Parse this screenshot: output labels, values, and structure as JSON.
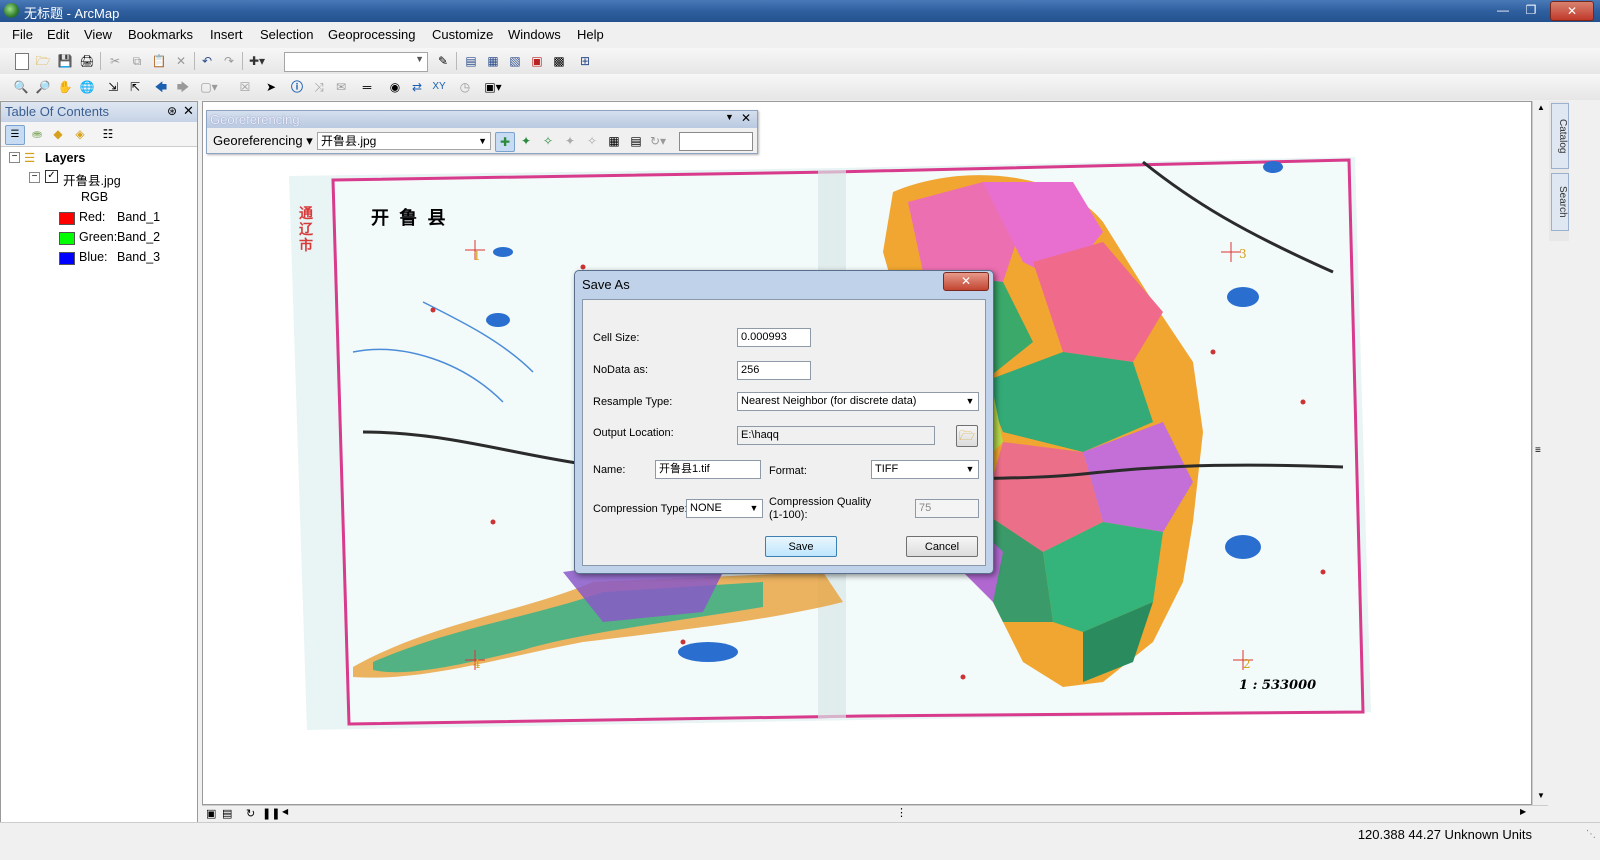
{
  "window": {
    "title": "无标题 - ArcMap"
  },
  "menu": [
    "File",
    "Edit",
    "View",
    "Bookmarks",
    "Insert",
    "Selection",
    "Geoprocessing",
    "Customize",
    "Windows",
    "Help"
  ],
  "toc": {
    "title": "Table Of Contents",
    "root": "Layers",
    "layer": "开鲁县.jpg",
    "renderer": "RGB",
    "bands": [
      {
        "channel": "Red:",
        "band": "Band_1",
        "color": "#ff0000"
      },
      {
        "channel": "Green:",
        "band": "Band_2",
        "color": "#00ff00"
      },
      {
        "channel": "Blue:",
        "band": "Band_3",
        "color": "#0000ff"
      }
    ]
  },
  "georef": {
    "title": "Georeferencing",
    "menu_label": "Georeferencing ▾",
    "layer_select": "开鲁县.jpg"
  },
  "map": {
    "title": "开 鲁 县",
    "neighbor": "通 辽 市",
    "scale": "1 : 533000"
  },
  "dock": {
    "catalog": "Catalog",
    "search": "Search"
  },
  "dialog": {
    "title": "Save As",
    "cell_size_label": "Cell Size:",
    "cell_size": "0.000993",
    "nodata_label": "NoData as:",
    "nodata": "256",
    "resample_label": "Resample Type:",
    "resample": "Nearest Neighbor (for discrete data)",
    "output_label": "Output Location:",
    "output": "E:\\haqq",
    "name_label": "Name:",
    "name": "开鲁县1.tif",
    "format_label": "Format:",
    "format": "TIFF",
    "compression_label": "Compression Type:",
    "compression": "NONE",
    "quality_label": "Compression Quality (1-100):",
    "quality": "75",
    "save_label": "Save",
    "cancel_label": "Cancel"
  },
  "status": {
    "coords": "120.388  44.27 Unknown Units"
  }
}
